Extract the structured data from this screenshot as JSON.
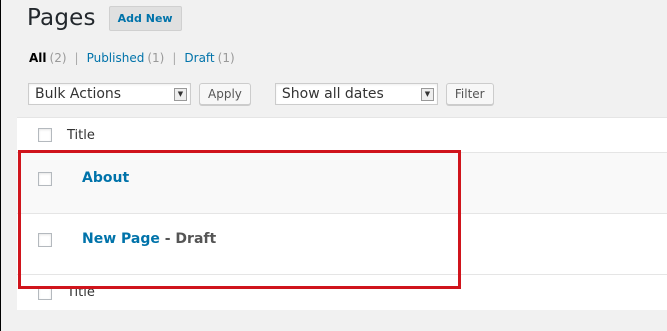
{
  "header": {
    "title": "Pages",
    "add_new_label": "Add New"
  },
  "filters": {
    "all": {
      "label": "All",
      "count": "(2)"
    },
    "published": {
      "label": "Published",
      "count": "(1)"
    },
    "draft": {
      "label": "Draft",
      "count": "(1)"
    },
    "separator": "|"
  },
  "toolbar": {
    "bulk_actions": "Bulk Actions",
    "apply_label": "Apply",
    "dates": "Show all dates",
    "filter_label": "Filter",
    "dropdown_arrow": "▼"
  },
  "table": {
    "column_title": "Title",
    "rows": [
      {
        "title": "About",
        "state": ""
      },
      {
        "title": "New Page",
        "state": " - Draft"
      }
    ]
  },
  "colors": {
    "link": "#0073aa",
    "highlight": "#d0141c",
    "background": "#f1f1f1"
  }
}
